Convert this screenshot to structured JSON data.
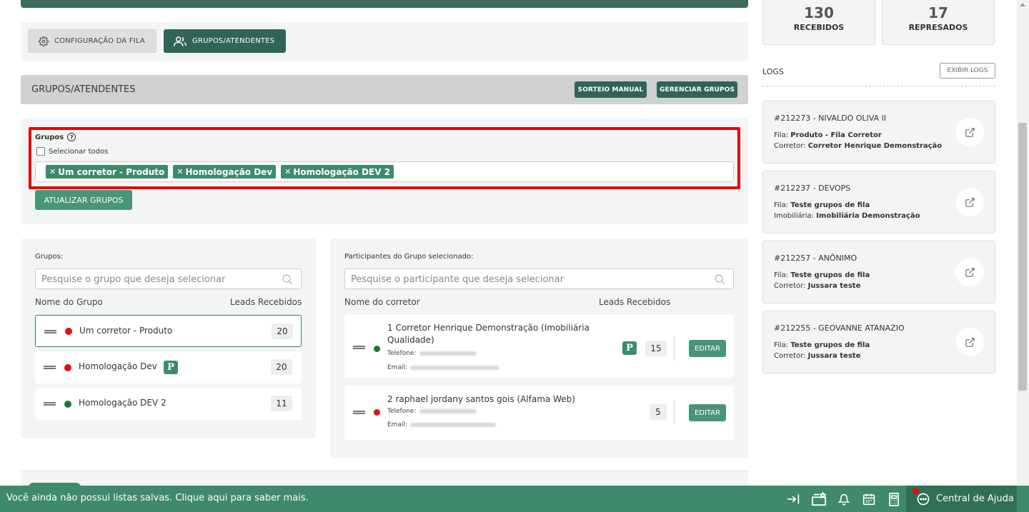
{
  "tabs": {
    "config_label": "CONFIGURAÇÃO DA FILA",
    "grupos_label": "GRUPOS/ATENDENTES"
  },
  "section": {
    "title": "GRUPOS/ATENDENTES",
    "sorteio_label": "SORTEIO MANUAL",
    "gerenciar_label": "GERENCIAR GRUPOS"
  },
  "grupos_select": {
    "label": "Grupos",
    "help": "?",
    "select_all": "Selecionar todos",
    "tags": [
      "Um corretor - Produto",
      "Homologação Dev",
      "Homologação DEV 2"
    ],
    "update_button": "ATUALIZAR GRUPOS"
  },
  "groups_panel": {
    "label": "Grupos:",
    "search_placeholder": "Pesquise o grupo que deseja selecionar",
    "col_name": "Nome do Grupo",
    "col_leads": "Leads Recebidos",
    "rows": [
      {
        "name": "Um corretor - Produto",
        "status": "red",
        "leads": "20",
        "priority": ""
      },
      {
        "name": "Homologação Dev",
        "status": "red",
        "leads": "20",
        "priority": "P"
      },
      {
        "name": "Homologação DEV 2",
        "status": "green",
        "leads": "11",
        "priority": ""
      }
    ]
  },
  "participants_panel": {
    "label": "Participantes do Grupo selecionado:",
    "search_placeholder": "Pesquise o participante que deseja selecionar",
    "col_name": "Nome do corretor",
    "col_leads": "Leads Recebidos",
    "phone_label": "Telefone:",
    "email_label": "Email:",
    "edit_label": "EDITAR",
    "rows": [
      {
        "name": "1 Corretor Henrique Demonstração (Imobiliária Qualidade)",
        "status": "green",
        "leads": "15",
        "priority": "P"
      },
      {
        "name": "2 raphael jordany santos gois (Alfama Web)",
        "status": "red",
        "leads": "5",
        "priority": ""
      }
    ]
  },
  "stats": [
    {
      "value": "130",
      "label": "RECEBIDOS"
    },
    {
      "value": "17",
      "label": "REPRESADOS"
    }
  ],
  "logs": {
    "title": "LOGS",
    "show_button": "EXIBIR LOGS",
    "items": [
      {
        "title": "#212273 - NIVALDO OLIVA II",
        "l1_key": "Fila:",
        "l1_val": "Produto - Fila Corretor",
        "l2_key": "Corretor:",
        "l2_val": "Corretor Henrique Demonstração"
      },
      {
        "title": "#212237 - DEVOPS",
        "l1_key": "Fila:",
        "l1_val": "Teste grupos de fila",
        "l2_key": "Imobiliária:",
        "l2_val": "Imobiliária Demonstração"
      },
      {
        "title": "#212257 - ANÔNIMO",
        "l1_key": "Fila:",
        "l1_val": "Teste grupos de fila",
        "l2_key": "Corretor:",
        "l2_val": "Jussara teste"
      },
      {
        "title": "#212255 - GEOVANNE ATANAZIO",
        "l1_key": "Fila:",
        "l1_val": "Teste grupos de fila",
        "l2_key": "Corretor:",
        "l2_val": "Jussara teste"
      }
    ]
  },
  "footer": {
    "message": "Você ainda não possui listas salvas. Clique aqui para saber mais.",
    "help_center": "Central de Ajuda"
  },
  "colors": {
    "brand_dark": "#2f6457",
    "brand": "#3f8a6c",
    "highlight": "#e60000",
    "status_red": "#e01010",
    "status_green": "#1a7a30"
  }
}
